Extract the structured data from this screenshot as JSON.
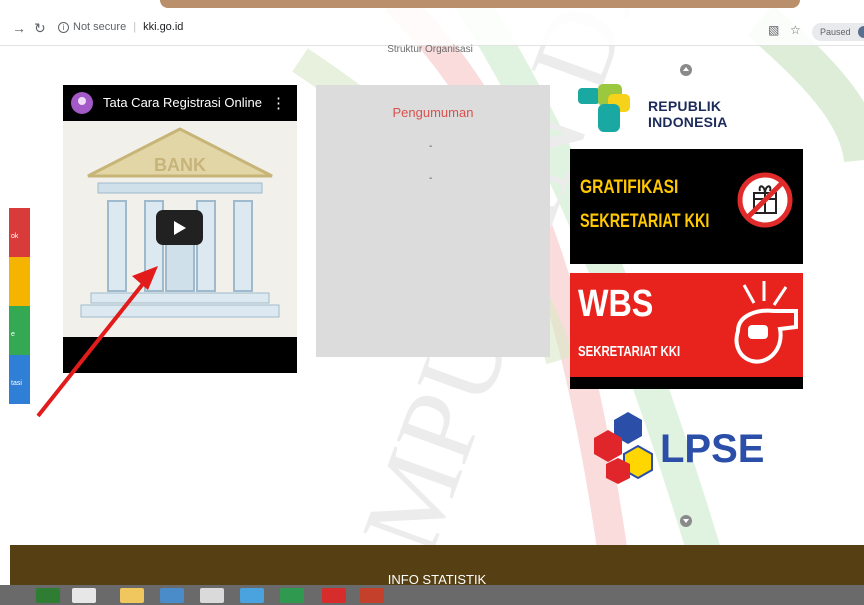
{
  "browser": {
    "security_label": "Not secure",
    "url": "kki.go.id",
    "profile_status": "Paused",
    "back_icon": "arrow-right-icon",
    "reload_icon": "reload-icon",
    "translate_icon": "translate-icon",
    "bookmark_icon": "star-icon"
  },
  "page": {
    "heading": "Struktur Organisasi"
  },
  "video": {
    "title": "Tata Cara Registrasi Online",
    "thumbnail_word": "BANK"
  },
  "announcement": {
    "title": "Pengumuman",
    "items": [
      "-",
      "-"
    ]
  },
  "banners": {
    "republik": "REPUBLIK INDONESIA",
    "gratifikasi_line1": "GRATIFIKASI",
    "gratifikasi_line2": "SEKRETARIAT KKI",
    "wbs_title": "WBS",
    "wbs_subtitle": "SEKRETARIAT KKI",
    "lpse": "LPSE"
  },
  "side_tabs": [
    {
      "label": "ok",
      "color": "#d93a3a"
    },
    {
      "label": "",
      "color": "#f4b400"
    },
    {
      "label": "e",
      "color": "#34a853"
    },
    {
      "label": "tasi",
      "color": "#2f7fd6"
    }
  ],
  "footer": {
    "title": "INFO STATISTIK"
  },
  "colors": {
    "announcement_title": "#d8514e",
    "footer_bg": "#563f12",
    "annotation_arrow": "#e21b1b"
  }
}
